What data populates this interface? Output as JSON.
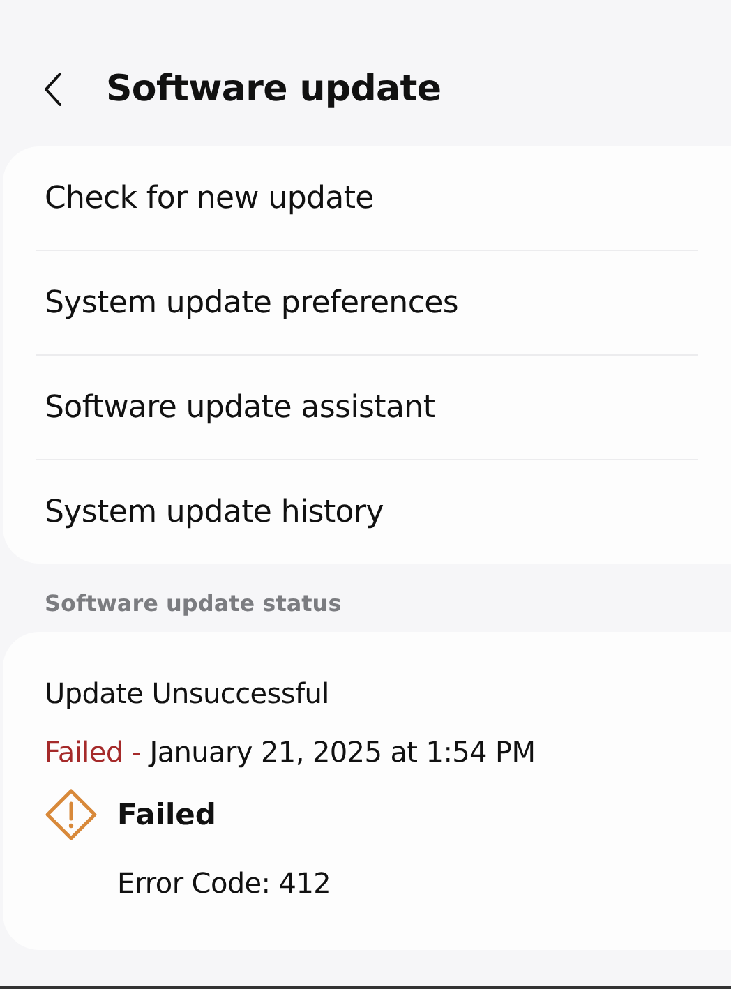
{
  "header": {
    "title": "Software update"
  },
  "menu": [
    {
      "label": "Check for new update"
    },
    {
      "label": "System update preferences"
    },
    {
      "label": "Software update assistant"
    },
    {
      "label": "System update history"
    }
  ],
  "status_section": {
    "heading": "Software update status",
    "title": "Update Unsuccessful",
    "result": "Failed -",
    "date": "January 21, 2025 at 1:54 PM",
    "badge": {
      "kind": "warning",
      "label": "Failed",
      "detail": "Error Code: 412"
    }
  }
}
